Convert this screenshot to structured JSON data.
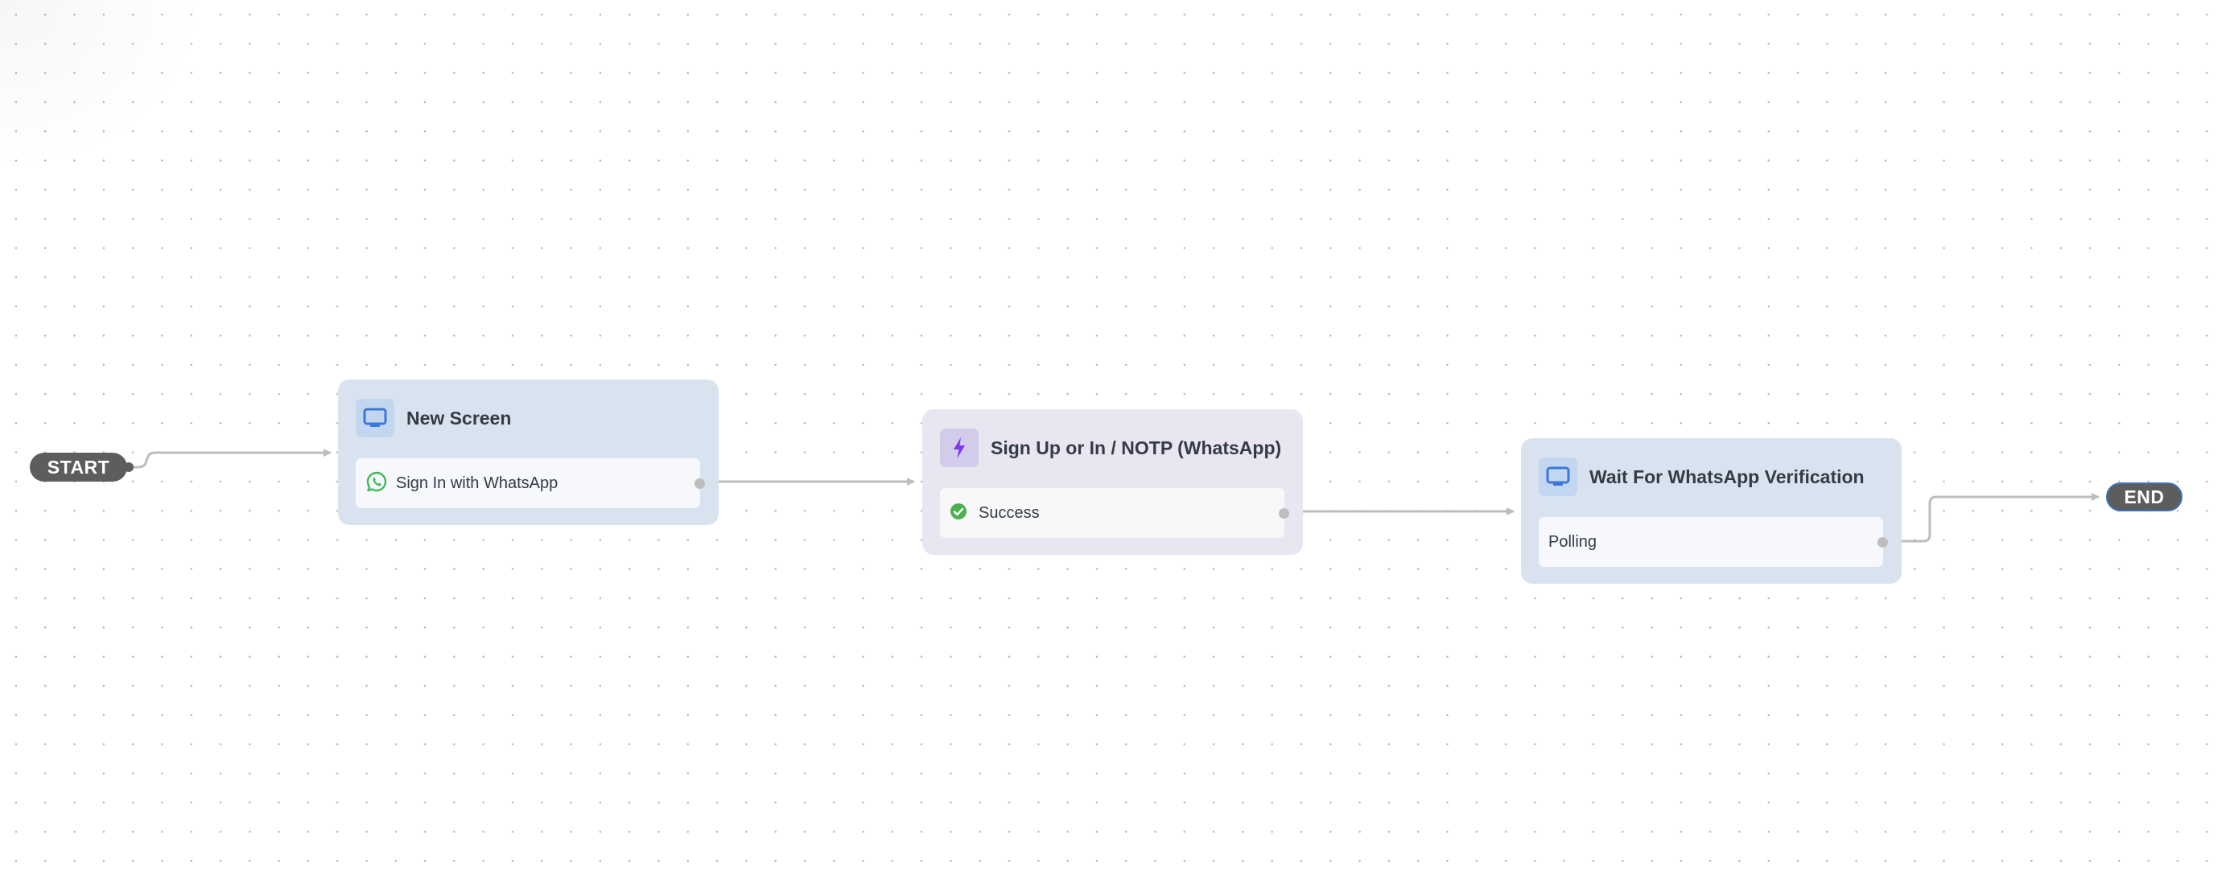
{
  "flow": {
    "start": {
      "label": "START"
    },
    "end": {
      "label": "END"
    },
    "nodes": [
      {
        "type": "screen",
        "icon": "monitor-icon",
        "title": "New Screen",
        "outputs": [
          {
            "icon": "whatsapp-icon",
            "label": "Sign In with WhatsApp"
          }
        ]
      },
      {
        "type": "action",
        "icon": "lightning-icon",
        "title": "Sign Up or In / NOTP (WhatsApp)",
        "outputs": [
          {
            "icon": "check-circle-icon",
            "label": "Success"
          }
        ]
      },
      {
        "type": "screen",
        "icon": "monitor-icon",
        "title": "Wait For WhatsApp Verification",
        "outputs": [
          {
            "icon": null,
            "label": "Polling"
          }
        ]
      }
    ],
    "edges": [
      {
        "from": "start",
        "to": "New Screen"
      },
      {
        "from": "Sign In with WhatsApp",
        "to": "Sign Up or In / NOTP (WhatsApp)"
      },
      {
        "from": "Success",
        "to": "Wait For WhatsApp Verification"
      },
      {
        "from": "Polling",
        "to": "end"
      }
    ],
    "colors": {
      "screen_node_bg": "#d9e3ef",
      "action_node_bg": "#e9e6f2",
      "screen_icon": "#3b78d8",
      "action_icon": "#7c3aed",
      "success": "#4caf50",
      "whatsapp": "#3fba5a",
      "terminal_pill": "#5d5d5d",
      "edge": "#bdbdbd",
      "selected_border": "#3f73b8"
    }
  }
}
